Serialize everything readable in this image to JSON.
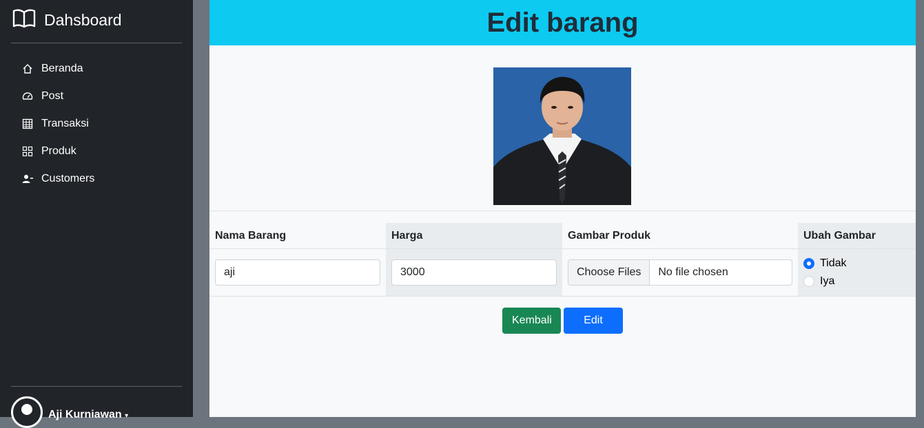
{
  "sidebar": {
    "brand": "Dahsboard",
    "items": [
      {
        "label": "Beranda"
      },
      {
        "label": "Post"
      },
      {
        "label": "Transaksi"
      },
      {
        "label": "Produk"
      },
      {
        "label": "Customers"
      }
    ],
    "user": {
      "name": "Aji Kurniawan"
    }
  },
  "main": {
    "title": "Edit barang",
    "form": {
      "columns": [
        "Nama Barang",
        "Harga",
        "Gambar Produk",
        "Ubah Gambar"
      ],
      "nama_value": "aji",
      "harga_value": "3000",
      "file_button": "Choose Files",
      "file_status": "No file chosen",
      "radio_options": [
        {
          "label": "Tidak",
          "checked": true
        },
        {
          "label": "Iya",
          "checked": false
        }
      ]
    },
    "buttons": {
      "back": "Kembali",
      "edit": "Edit"
    }
  },
  "colors": {
    "header": "#0dcaf0",
    "sidebar": "#212529",
    "back": "#198754",
    "edit": "#0d6efd"
  }
}
